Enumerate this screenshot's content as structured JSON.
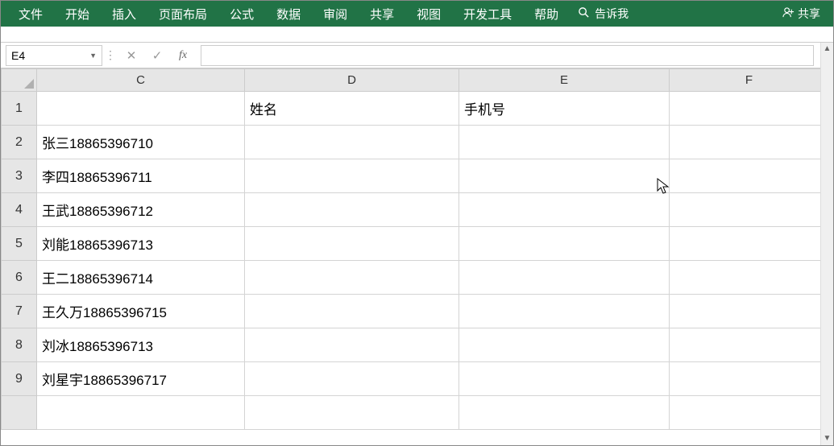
{
  "ribbon": {
    "tabs": [
      "文件",
      "开始",
      "插入",
      "页面布局",
      "公式",
      "数据",
      "审阅",
      "共享",
      "视图",
      "开发工具",
      "帮助"
    ],
    "tellme": "告诉我",
    "share": "共享"
  },
  "formula_bar": {
    "name_box": "E4",
    "cancel": "✕",
    "confirm": "✓",
    "fx": "fx",
    "formula": ""
  },
  "columns": [
    "C",
    "D",
    "E",
    "F"
  ],
  "row_numbers": [
    "1",
    "2",
    "3",
    "4",
    "5",
    "6",
    "7",
    "8",
    "9"
  ],
  "cells": {
    "D1": "姓名",
    "E1": "手机号",
    "C2": "张三18865396710",
    "C3": "李四18865396711",
    "C4": "王武18865396712",
    "C5": "刘能18865396713",
    "C6": "王二18865396714",
    "C7": "王久万18865396715",
    "C8": "刘冰18865396713",
    "C9": "刘星宇18865396717"
  }
}
